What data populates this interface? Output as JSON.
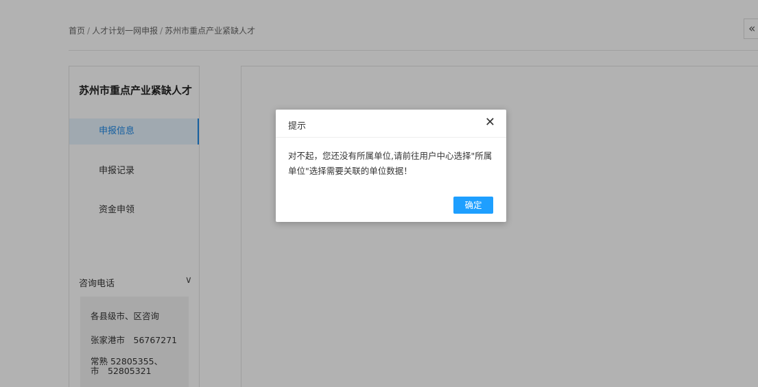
{
  "breadcrumb": {
    "items": [
      "首页",
      "人才计划一网申报",
      "苏州市重点产业紧缺人才"
    ],
    "separator": "/"
  },
  "collapse_button": {
    "label": "«"
  },
  "sidebar": {
    "title": "苏州市重点产业紧缺人才",
    "nav": [
      {
        "label": "申报信息",
        "active": true
      },
      {
        "label": "申报记录",
        "active": false
      },
      {
        "label": "资金申领",
        "active": false
      }
    ],
    "consult": {
      "header": "咨询电话",
      "chevron": "∨",
      "lines": [
        "各县级市、区咨询",
        "张家港市　56767271",
        "常熟 52805355、",
        "市　52805321"
      ]
    }
  },
  "dialog": {
    "title": "提示",
    "close": "✕",
    "message": "对不起，您还没有所属单位,请前往用户中心选择\"所属单位\"选择需要关联的单位数据！",
    "ok_label": "确定"
  },
  "colors": {
    "accent": "#1e88e5",
    "button": "#1e9fff",
    "mask": "rgba(0,0,0,0.30)"
  }
}
